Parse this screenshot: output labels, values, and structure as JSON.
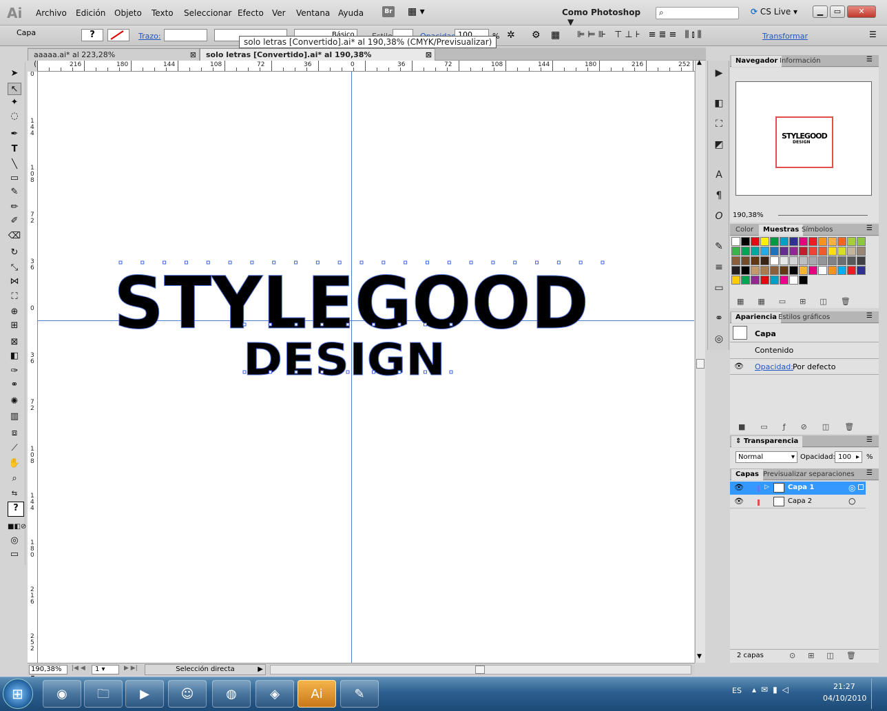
{
  "app": {
    "logo": "Ai",
    "br_badge": "Br"
  },
  "menubar": {
    "items": [
      "Archivo",
      "Edición",
      "Objeto",
      "Texto",
      "Seleccionar",
      "Efecto",
      "Ver",
      "Ventana",
      "Ayuda"
    ],
    "workspace": "Como Photoshop",
    "cslive": "CS Live"
  },
  "control": {
    "selection_label": "Capa",
    "stroke_label": "Trazo:",
    "basic_label": "Básico",
    "style_label": "Estilo:",
    "opacity_label": "Opacidad:",
    "opacity_value": "100",
    "opacity_unit": "%",
    "transform_label": "Transformar"
  },
  "tooltip": "solo letras [Convertido].ai* al 190,38% (CMYK/Previsualizar)",
  "tabs": [
    {
      "label": "aaaaa.ai* al 223,28% (CMYK/Previsualizar)",
      "active": false
    },
    {
      "label": "solo letras [Convertido].ai* al 190,38% (CMYK/Previsualizar)",
      "active": true
    }
  ],
  "ruler": {
    "h": [
      "216",
      "180",
      "144",
      "108",
      "72",
      "36",
      "0",
      "36",
      "72",
      "108",
      "144",
      "180",
      "216",
      "252"
    ],
    "v": [
      "0",
      "144",
      "108",
      "72",
      "36",
      "0",
      "36",
      "72",
      "108",
      "144",
      "180",
      "216",
      "252"
    ]
  },
  "artwork": {
    "line1": "STYLEGOOD",
    "line2": "DESIGN"
  },
  "status": {
    "zoom": "190,38%",
    "page": "1",
    "tool": "Selección directa"
  },
  "navigator": {
    "tabs": [
      "Navegador",
      "Información"
    ],
    "zoom": "190,38%",
    "preview_line1": "STYLEGOOD",
    "preview_line2": "DESIGN"
  },
  "swatches": {
    "tabs": [
      "Color",
      "Muestras",
      "Símbolos"
    ]
  },
  "appearance": {
    "tabs": [
      "Apariencia",
      "Estilos gráficos"
    ],
    "item": "Capa",
    "content": "Contenido",
    "opacity_label": "Opacidad:",
    "opacity_value": "Por defecto"
  },
  "transparency": {
    "title": "Transparencia",
    "mode": "Normal",
    "opacity_label": "Opacidad:",
    "opacity_value": "100",
    "unit": "%"
  },
  "layers": {
    "tabs": [
      "Capas",
      "Previsualizar separaciones"
    ],
    "items": [
      {
        "name": "Capa 1",
        "selected": true
      },
      {
        "name": "Capa 2",
        "selected": false
      }
    ],
    "count": "2 capas"
  },
  "taskbar": {
    "lang": "ES",
    "time": "21:27",
    "date": "04/10/2010"
  },
  "colors": {
    "accent": "#3399ff",
    "nav_frame": "#e0504a",
    "taskbar": "#2c5f8f"
  }
}
